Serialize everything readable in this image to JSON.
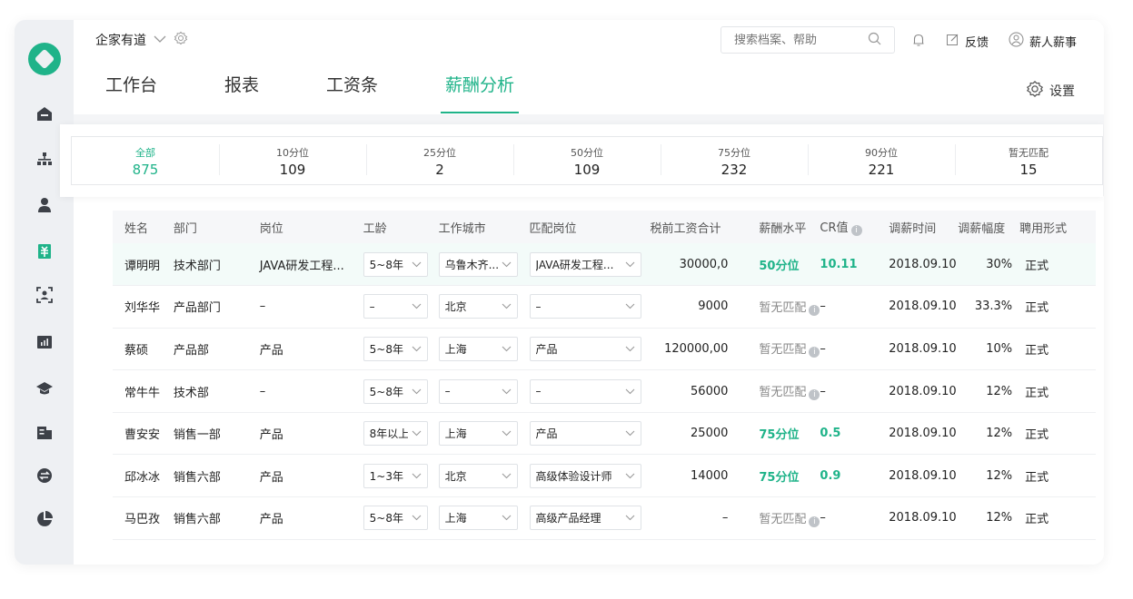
{
  "header": {
    "company": "企家有道",
    "search_placeholder": "搜索档案、帮助",
    "feedback": "反馈",
    "user": "薪人薪事",
    "settings": "设置"
  },
  "tabs": [
    {
      "label": "工作台",
      "active": false
    },
    {
      "label": "报表",
      "active": false
    },
    {
      "label": "工资条",
      "active": false
    },
    {
      "label": "薪酬分析",
      "active": true
    }
  ],
  "stats": [
    {
      "label": "全部",
      "value": "875",
      "active": true
    },
    {
      "label": "10分位",
      "value": "109"
    },
    {
      "label": "25分位",
      "value": "2"
    },
    {
      "label": "50分位",
      "value": "109"
    },
    {
      "label": "75分位",
      "value": "232"
    },
    {
      "label": "90分位",
      "value": "221"
    },
    {
      "label": "暂无匹配",
      "value": "15"
    }
  ],
  "table": {
    "headers": [
      "姓名",
      "部门",
      "岗位",
      "工龄",
      "工作城市",
      "匹配岗位",
      "税前工资合计",
      "薪酬水平",
      "CR值",
      "调薪时间",
      "调薪幅度",
      "聘用形式"
    ],
    "rows": [
      [
        "谭明明",
        "技术部门",
        "JAVA研发工程...",
        "5~8年",
        "乌鲁木齐...",
        "JAVA研发工程...",
        "30000,0",
        "50分位",
        "10.11",
        "2018.09.10",
        "30%",
        "正式"
      ],
      [
        "刘华华",
        "产品部门",
        "–",
        "–",
        "北京",
        "–",
        "9000",
        "暂无匹配",
        "–",
        "2018.09.10",
        "33.3%",
        "正式"
      ],
      [
        "蔡硕",
        "产品部",
        "产品",
        "5~8年",
        "上海",
        "产品",
        "120000,00",
        "暂无匹配",
        "–",
        "2018.09.10",
        "10%",
        "正式"
      ],
      [
        "常牛牛",
        "技术部",
        "–",
        "5~8年",
        "–",
        "–",
        "56000",
        "暂无匹配",
        "–",
        "2018.09.10",
        "12%",
        "正式"
      ],
      [
        "曹安安",
        "销售一部",
        "产品",
        "8年以上",
        "上海",
        "产品",
        "25000",
        "75分位",
        "0.5",
        "2018.09.10",
        "12%",
        "正式"
      ],
      [
        "邱冰冰",
        "销售六部",
        "产品",
        "1~3年",
        "北京",
        "高级体验设计师",
        "14000",
        "75分位",
        "0.9",
        "2018.09.10",
        "12%",
        "正式"
      ],
      [
        "马巴孜",
        "销售六部",
        "产品",
        "5~8年",
        "上海",
        "高级产品经理",
        "–",
        "暂无匹配",
        "–",
        "2018.09.10",
        "12%",
        "正式"
      ]
    ],
    "highlighted_row": 0
  },
  "colors": {
    "accent": "#1fb389"
  }
}
